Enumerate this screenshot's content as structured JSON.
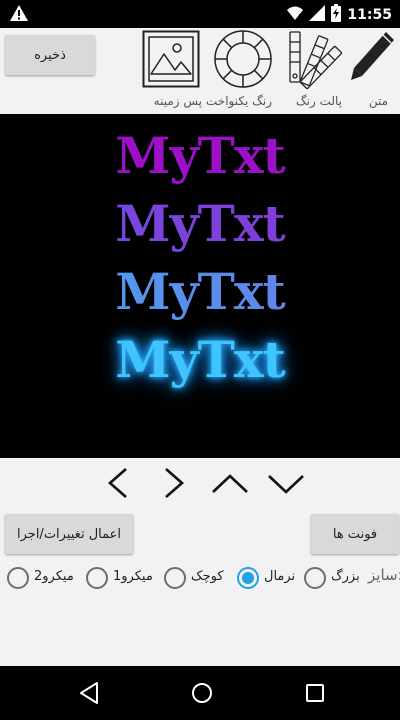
{
  "status_bar": {
    "time": "11:55",
    "icons": [
      "warning-icon",
      "wifi-icon",
      "signal-icon",
      "battery-charging-icon"
    ]
  },
  "toolbar": {
    "save_label": "ذخیره",
    "tools": [
      {
        "icon": "image-icon",
        "label": "پس زمینه"
      },
      {
        "icon": "color-wheel-icon",
        "label": "رنگ یکنواخت"
      },
      {
        "icon": "color-palette-icon",
        "label": "پالت رنگ"
      },
      {
        "icon": "pencil-icon",
        "label": "متن"
      }
    ]
  },
  "preview": {
    "background": "#000000",
    "samples": [
      "MyTxt",
      "MyTxt",
      "MyTxt",
      "MyTxt"
    ],
    "colors": [
      "#9c10c8",
      "#7b44dc",
      "#5a8ef0",
      "#3fc4ff"
    ]
  },
  "arrows": [
    "chevron-left-icon",
    "chevron-right-icon",
    "chevron-up-icon",
    "chevron-down-icon"
  ],
  "buttons": {
    "apply_label": "اعمال تغییرات/اجرا",
    "fonts_label": "فونت ها"
  },
  "size": {
    "label": "سایز:",
    "options": [
      {
        "label": "بزرگ",
        "checked": false
      },
      {
        "label": "نرمال",
        "checked": true
      },
      {
        "label": "کوچک",
        "checked": false
      },
      {
        "label": "میکرو1",
        "checked": false
      },
      {
        "label": "میکرو2",
        "checked": false
      }
    ]
  },
  "accent_color": "#1ea1e6",
  "nav_bar": [
    "back-icon",
    "home-icon",
    "recents-icon"
  ]
}
